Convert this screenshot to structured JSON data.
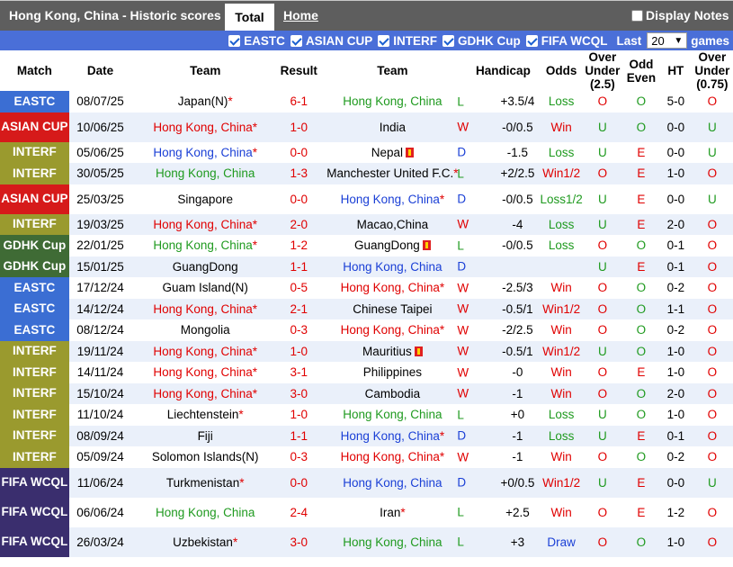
{
  "header": {
    "title": "Hong Kong, China - Historic scores",
    "tab_total": "Total",
    "tab_home": "Home",
    "display_notes": "Display Notes"
  },
  "filters": {
    "items": [
      "EASTC",
      "ASIAN CUP",
      "INTERF",
      "GDHK Cup",
      "FIFA WCQL"
    ],
    "last_label": "Last",
    "last_value": "20",
    "games_label": "games"
  },
  "columns": [
    "Match",
    "Date",
    "Team",
    "Result",
    "Team",
    "Handicap",
    "Odds",
    "Over Under (2.5)",
    "Odd Even",
    "HT",
    "Over Under (0.75)"
  ],
  "colors": {
    "EASTC": "#3b6ed3",
    "ASIAN CUP": "#d61a1a",
    "INTERF": "#9a9a2e",
    "GDHK Cup": "#3f6b35",
    "FIFA WCQL": "#3a2e6e",
    "win": "#e00000",
    "draw": "#1a3fd6",
    "loss": "#1f9a1f"
  },
  "rows": [
    {
      "match": "EASTC",
      "date": "08/07/25",
      "home": "Japan(N)",
      "home_star": "*",
      "home_flag": "",
      "result": "6-1",
      "away": "Hong Kong, China",
      "away_star": "",
      "away_flag": "",
      "wl": "L",
      "hcp": "+3.5/4",
      "odds": "Loss",
      "ou": "O",
      "oe": "O",
      "ht": "5-0",
      "ou2": "O"
    },
    {
      "match": "ASIAN CUP",
      "date": "10/06/25",
      "home": "Hong Kong, China",
      "home_star": "*",
      "home_flag": "",
      "result": "1-0",
      "away": "India",
      "away_star": "",
      "away_flag": "",
      "wl": "W",
      "hcp": "-0/0.5",
      "odds": "Win",
      "ou": "U",
      "oe": "O",
      "ht": "0-0",
      "ou2": "U"
    },
    {
      "match": "INTERF",
      "date": "05/06/25",
      "home": "Hong Kong, China",
      "home_star": "*",
      "home_flag": "",
      "result": "0-0",
      "away": "Nepal",
      "away_star": "",
      "away_flag": "1",
      "wl": "D",
      "hcp": "-1.5",
      "odds": "Loss",
      "ou": "U",
      "oe": "E",
      "ht": "0-0",
      "ou2": "U"
    },
    {
      "match": "INTERF",
      "date": "30/05/25",
      "home": "Hong Kong, China",
      "home_star": "",
      "home_flag": "",
      "result": "1-3",
      "away": "Manchester United F.C.",
      "away_star": "*",
      "away_flag": "",
      "wl": "L",
      "hcp": "+2/2.5",
      "odds": "Win1/2",
      "ou": "O",
      "oe": "E",
      "ht": "1-0",
      "ou2": "O"
    },
    {
      "match": "ASIAN CUP",
      "date": "25/03/25",
      "home": "Singapore",
      "home_star": "",
      "home_flag": "",
      "result": "0-0",
      "away": "Hong Kong, China",
      "away_star": "*",
      "away_flag": "",
      "wl": "D",
      "hcp": "-0/0.5",
      "odds": "Loss1/2",
      "ou": "U",
      "oe": "E",
      "ht": "0-0",
      "ou2": "U"
    },
    {
      "match": "INTERF",
      "date": "19/03/25",
      "home": "Hong Kong, China",
      "home_star": "*",
      "home_flag": "",
      "result": "2-0",
      "away": "Macao,China",
      "away_star": "",
      "away_flag": "",
      "wl": "W",
      "hcp": "-4",
      "odds": "Loss",
      "ou": "U",
      "oe": "E",
      "ht": "2-0",
      "ou2": "O"
    },
    {
      "match": "GDHK Cup",
      "date": "22/01/25",
      "home": "Hong Kong, China",
      "home_star": "*",
      "home_flag": "",
      "result": "1-2",
      "away": "GuangDong",
      "away_star": "",
      "away_flag": "1",
      "wl": "L",
      "hcp": "-0/0.5",
      "odds": "Loss",
      "ou": "O",
      "oe": "O",
      "ht": "0-1",
      "ou2": "O"
    },
    {
      "match": "GDHK Cup",
      "date": "15/01/25",
      "home": "GuangDong",
      "home_star": "",
      "home_flag": "",
      "result": "1-1",
      "away": "Hong Kong, China",
      "away_star": "",
      "away_flag": "",
      "wl": "D",
      "hcp": "",
      "odds": "",
      "ou": "U",
      "oe": "E",
      "ht": "0-1",
      "ou2": "O"
    },
    {
      "match": "EASTC",
      "date": "17/12/24",
      "home": "Guam Island(N)",
      "home_star": "",
      "home_flag": "",
      "result": "0-5",
      "away": "Hong Kong, China",
      "away_star": "*",
      "away_flag": "",
      "wl": "W",
      "hcp": "-2.5/3",
      "odds": "Win",
      "ou": "O",
      "oe": "O",
      "ht": "0-2",
      "ou2": "O"
    },
    {
      "match": "EASTC",
      "date": "14/12/24",
      "home": "Hong Kong, China",
      "home_star": "*",
      "home_flag": "",
      "result": "2-1",
      "away": "Chinese Taipei",
      "away_star": "",
      "away_flag": "",
      "wl": "W",
      "hcp": "-0.5/1",
      "odds": "Win1/2",
      "ou": "O",
      "oe": "O",
      "ht": "1-1",
      "ou2": "O"
    },
    {
      "match": "EASTC",
      "date": "08/12/24",
      "home": "Mongolia",
      "home_star": "",
      "home_flag": "",
      "result": "0-3",
      "away": "Hong Kong, China",
      "away_star": "*",
      "away_flag": "",
      "wl": "W",
      "hcp": "-2/2.5",
      "odds": "Win",
      "ou": "O",
      "oe": "O",
      "ht": "0-2",
      "ou2": "O"
    },
    {
      "match": "INTERF",
      "date": "19/11/24",
      "home": "Hong Kong, China",
      "home_star": "*",
      "home_flag": "",
      "result": "1-0",
      "away": "Mauritius",
      "away_star": "",
      "away_flag": "1",
      "wl": "W",
      "hcp": "-0.5/1",
      "odds": "Win1/2",
      "ou": "U",
      "oe": "O",
      "ht": "1-0",
      "ou2": "O"
    },
    {
      "match": "INTERF",
      "date": "14/11/24",
      "home": "Hong Kong, China",
      "home_star": "*",
      "home_flag": "",
      "result": "3-1",
      "away": "Philippines",
      "away_star": "",
      "away_flag": "",
      "wl": "W",
      "hcp": "-0",
      "odds": "Win",
      "ou": "O",
      "oe": "E",
      "ht": "1-0",
      "ou2": "O"
    },
    {
      "match": "INTERF",
      "date": "15/10/24",
      "home": "Hong Kong, China",
      "home_star": "*",
      "home_flag": "",
      "result": "3-0",
      "away": "Cambodia",
      "away_star": "",
      "away_flag": "",
      "wl": "W",
      "hcp": "-1",
      "odds": "Win",
      "ou": "O",
      "oe": "O",
      "ht": "2-0",
      "ou2": "O"
    },
    {
      "match": "INTERF",
      "date": "11/10/24",
      "home": "Liechtenstein",
      "home_star": "*",
      "home_flag": "",
      "result": "1-0",
      "away": "Hong Kong, China",
      "away_star": "",
      "away_flag": "",
      "wl": "L",
      "hcp": "+0",
      "odds": "Loss",
      "ou": "U",
      "oe": "O",
      "ht": "1-0",
      "ou2": "O"
    },
    {
      "match": "INTERF",
      "date": "08/09/24",
      "home": "Fiji",
      "home_star": "",
      "home_flag": "",
      "result": "1-1",
      "away": "Hong Kong, China",
      "away_star": "*",
      "away_flag": "",
      "wl": "D",
      "hcp": "-1",
      "odds": "Loss",
      "ou": "U",
      "oe": "E",
      "ht": "0-1",
      "ou2": "O"
    },
    {
      "match": "INTERF",
      "date": "05/09/24",
      "home": "Solomon Islands(N)",
      "home_star": "",
      "home_flag": "",
      "result": "0-3",
      "away": "Hong Kong, China",
      "away_star": "*",
      "away_flag": "",
      "wl": "W",
      "hcp": "-1",
      "odds": "Win",
      "ou": "O",
      "oe": "O",
      "ht": "0-2",
      "ou2": "O"
    },
    {
      "match": "FIFA WCQL",
      "date": "11/06/24",
      "home": "Turkmenistan",
      "home_star": "*",
      "home_flag": "",
      "result": "0-0",
      "away": "Hong Kong, China",
      "away_star": "",
      "away_flag": "",
      "wl": "D",
      "hcp": "+0/0.5",
      "odds": "Win1/2",
      "ou": "U",
      "oe": "E",
      "ht": "0-0",
      "ou2": "U"
    },
    {
      "match": "FIFA WCQL",
      "date": "06/06/24",
      "home": "Hong Kong, China",
      "home_star": "",
      "home_flag": "",
      "result": "2-4",
      "away": "Iran",
      "away_star": "*",
      "away_flag": "",
      "wl": "L",
      "hcp": "+2.5",
      "odds": "Win",
      "ou": "O",
      "oe": "E",
      "ht": "1-2",
      "ou2": "O"
    },
    {
      "match": "FIFA WCQL",
      "date": "26/03/24",
      "home": "Uzbekistan",
      "home_star": "*",
      "home_flag": "",
      "result": "3-0",
      "away": "Hong Kong, China",
      "away_star": "",
      "away_flag": "",
      "wl": "L",
      "hcp": "+3",
      "odds": "Draw",
      "ou": "O",
      "oe": "O",
      "ht": "1-0",
      "ou2": "O"
    }
  ]
}
